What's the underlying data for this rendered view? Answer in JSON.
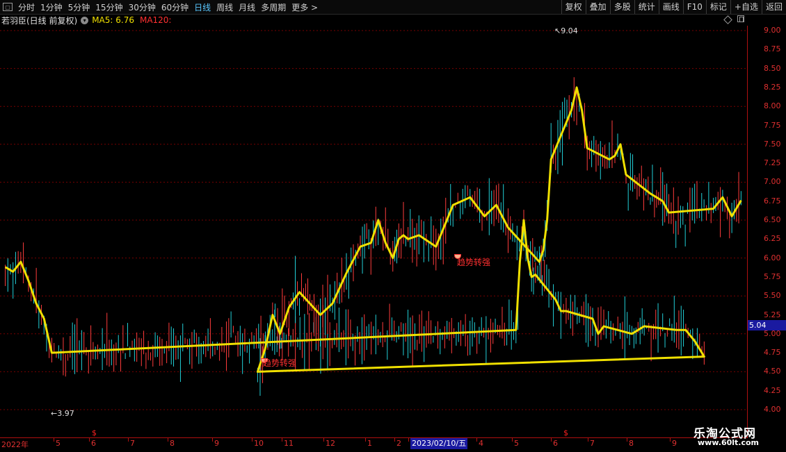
{
  "toolbar": {
    "tabs": [
      {
        "label": "分时",
        "active": false
      },
      {
        "label": "1分钟",
        "active": false
      },
      {
        "label": "5分钟",
        "active": false
      },
      {
        "label": "15分钟",
        "active": false
      },
      {
        "label": "30分钟",
        "active": false
      },
      {
        "label": "60分钟",
        "active": false
      },
      {
        "label": "日线",
        "active": true
      },
      {
        "label": "周线",
        "active": false
      },
      {
        "label": "月线",
        "active": false
      },
      {
        "label": "多周期",
        "active": false
      },
      {
        "label": "更多 >",
        "active": false
      }
    ],
    "right_buttons": [
      "复权",
      "叠加",
      "多股",
      "统计",
      "画线",
      "F10",
      "标记",
      "+自选",
      "返回"
    ]
  },
  "info": {
    "stock": "若羽臣(日线 前复权)",
    "ma5": "MA5: 6.76",
    "ma120": "MA120:"
  },
  "axis": {
    "y_ticks": [
      "9.00",
      "8.75",
      "8.50",
      "8.25",
      "8.00",
      "7.75",
      "7.50",
      "7.25",
      "7.00",
      "6.75",
      "6.50",
      "6.25",
      "6.00",
      "5.75",
      "5.50",
      "5.25",
      "5.00",
      "4.75",
      "4.50",
      "4.25",
      "4.00"
    ],
    "y_highlight": "5.04",
    "x_labels": [
      "2022年",
      "5",
      "6",
      "7",
      "8",
      "9",
      "10",
      "11",
      "12",
      "1",
      "2",
      "2023/02/10/五",
      "4",
      "5",
      "6",
      "7",
      "8",
      "9"
    ],
    "dollar_mark": "$"
  },
  "annotations": {
    "high": "9.04",
    "low": "3.97",
    "signal_label": "趋势转强"
  },
  "watermark": {
    "line1": "乐淘公式网",
    "line2": "www.60lt.com"
  },
  "colors": {
    "up": "#ff3c3c",
    "down": "#22d0d8",
    "ma5": "#f0e000",
    "grid": "#7a0000",
    "axis": "#b01010"
  },
  "chart_data": {
    "type": "candlestick",
    "title": "若羽臣(日线 前复权)",
    "ylim": [
      4.0,
      9.0
    ],
    "series_name": "MA5",
    "x_range": [
      "2022年",
      "9"
    ],
    "ma5_points": [
      [
        "2022年",
        5.88
      ],
      [
        "2022年",
        5.82
      ],
      [
        "2022年",
        5.95
      ],
      [
        "2022年",
        5.7
      ],
      [
        "2022年",
        5.4
      ],
      [
        "2022年",
        5.2
      ],
      [
        "2022年",
        4.75
      ],
      [
        "5",
        5.05
      ],
      [
        "5",
        5.95
      ],
      [
        "5",
        6.5
      ],
      [
        "5",
        6.0
      ],
      [
        "5",
        5.75
      ],
      [
        "5",
        5.78
      ],
      [
        "6",
        5.45
      ],
      [
        "6",
        5.3
      ],
      [
        "6",
        5.3
      ],
      [
        "7",
        5.2
      ],
      [
        "7",
        5.0
      ],
      [
        "7",
        5.1
      ],
      [
        "8",
        5.0
      ],
      [
        "8",
        5.05
      ],
      [
        "8",
        5.1
      ],
      [
        "9",
        5.05
      ],
      [
        "9",
        5.05
      ],
      [
        "9",
        4.9
      ],
      [
        "9",
        4.7
      ],
      [
        "10",
        4.5
      ],
      [
        "10",
        4.8
      ],
      [
        "10",
        5.25
      ],
      [
        "10",
        5.0
      ],
      [
        "11",
        5.35
      ],
      [
        "11",
        5.55
      ],
      [
        "11",
        5.4
      ],
      [
        "11",
        5.25
      ],
      [
        "12",
        5.4
      ],
      [
        "12",
        5.8
      ],
      [
        "12",
        6.15
      ],
      [
        "1",
        6.2
      ],
      [
        "1",
        6.5
      ],
      [
        "1",
        6.2
      ],
      [
        "1",
        6.0
      ],
      [
        "2",
        6.25
      ],
      [
        "2",
        6.3
      ],
      [
        "2",
        6.25
      ],
      [
        "2023/02/10/五",
        6.3
      ],
      [
        "2023/02/10/五",
        6.15
      ],
      [
        "2023/02/10/五",
        6.7
      ],
      [
        "2023/02/10/五",
        6.8
      ],
      [
        "4",
        6.55
      ],
      [
        "4",
        6.7
      ],
      [
        "4",
        6.4
      ],
      [
        "5",
        5.95
      ],
      [
        "5",
        6.1
      ],
      [
        "5",
        6.5
      ],
      [
        "5",
        7.3
      ],
      [
        "6",
        7.95
      ],
      [
        "6",
        8.25
      ],
      [
        "6",
        7.95
      ],
      [
        "6",
        7.45
      ],
      [
        "7",
        7.3
      ],
      [
        "7",
        7.35
      ],
      [
        "7",
        7.5
      ],
      [
        "7",
        7.1
      ],
      [
        "8",
        6.85
      ],
      [
        "8",
        6.8
      ],
      [
        "8",
        6.75
      ],
      [
        "8",
        6.6
      ],
      [
        "9",
        6.65
      ],
      [
        "9",
        6.8
      ],
      [
        "9",
        6.55
      ],
      [
        "9",
        6.76
      ]
    ],
    "extremes": {
      "high": 9.04,
      "low": 3.97
    },
    "last_ma5": 6.76
  }
}
